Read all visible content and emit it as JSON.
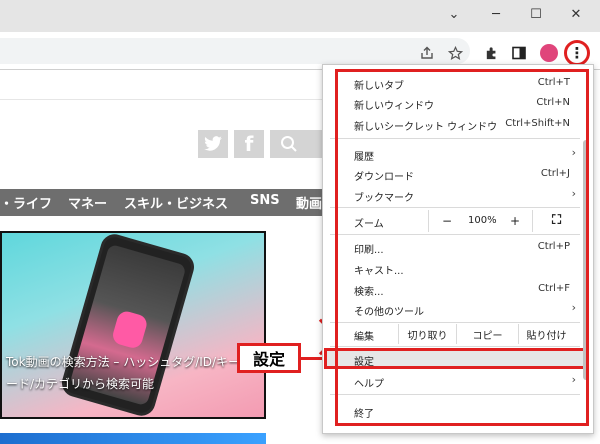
{
  "window_controls": {
    "dropdown": "⌄",
    "minimize": "─",
    "maximize": "☐",
    "close": "✕"
  },
  "toolbar_icons": {
    "share": "share-icon",
    "bookmark": "star-icon",
    "extensions": "puzzle-icon",
    "sidepanel": "side-panel-icon",
    "menu": "⋮"
  },
  "page": {
    "social": {
      "twitter": "twitter-icon",
      "facebook": "f",
      "search": "search-icon"
    },
    "nav": [
      "・ライフ",
      "マネー",
      "スキル・ビジネス",
      "SNS",
      "動画"
    ],
    "article_caption": "Tok動画の検索方法 – ハッシュタグ/ID/キーワード/カテゴリから検索可能"
  },
  "callout": {
    "label": "設定"
  },
  "menu": {
    "group1": [
      {
        "label": "新しいタブ",
        "shortcut": "Ctrl+T"
      },
      {
        "label": "新しいウィンドウ",
        "shortcut": "Ctrl+N"
      },
      {
        "label": "新しいシークレット ウィンドウ",
        "shortcut": "Ctrl+Shift+N"
      }
    ],
    "group2": [
      {
        "label": "履歴",
        "chevron": "›"
      },
      {
        "label": "ダウンロード",
        "shortcut": "Ctrl+J"
      },
      {
        "label": "ブックマーク",
        "chevron": "›"
      }
    ],
    "zoom": {
      "label": "ズーム",
      "minus": "−",
      "value": "100%",
      "plus": "+",
      "fullscreen": "⛶"
    },
    "group3": [
      {
        "label": "印刷...",
        "shortcut": "Ctrl+P"
      },
      {
        "label": "キャスト..."
      },
      {
        "label": "検索...",
        "shortcut": "Ctrl+F"
      },
      {
        "label": "その他のツール",
        "chevron": "›"
      }
    ],
    "edit": {
      "label": "編集",
      "cut": "切り取り",
      "copy": "コピー",
      "paste": "貼り付け"
    },
    "settings": "設定",
    "help": {
      "label": "ヘルプ",
      "chevron": "›"
    },
    "exit": "終了"
  },
  "colors": {
    "accent_red": "#e02020",
    "profile": "#e0457b",
    "nav_bg": "#6e6e6e"
  }
}
